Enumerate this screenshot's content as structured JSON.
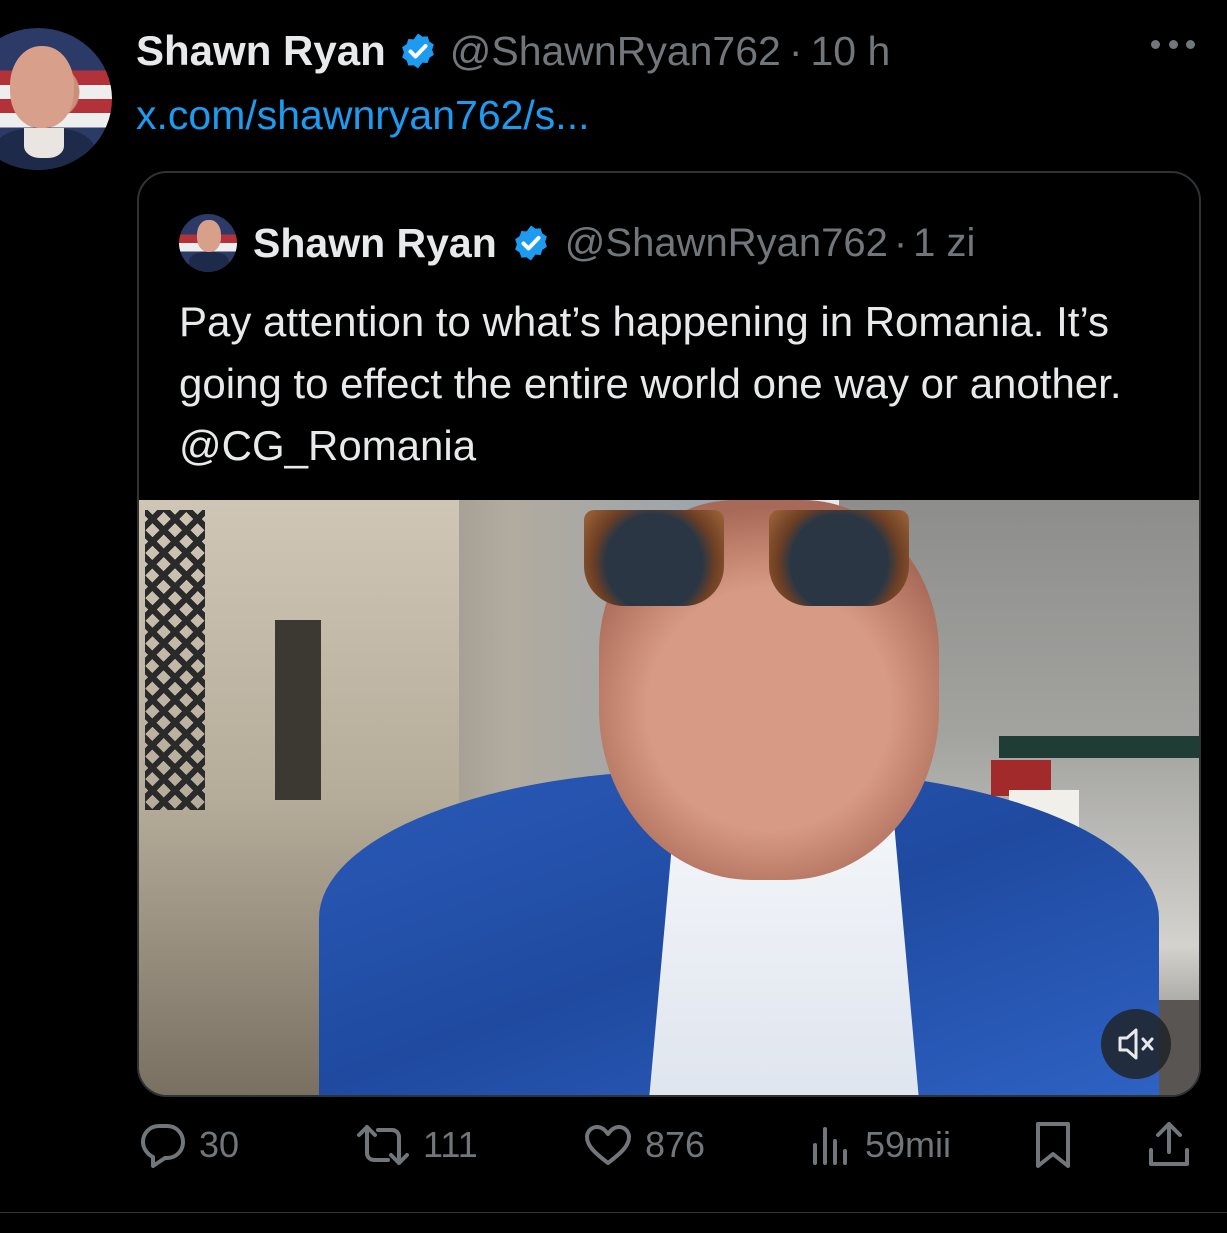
{
  "tweet": {
    "author_name": "Shawn Ryan",
    "author_handle": "@ShawnRyan762",
    "separator": "·",
    "timestamp": "10 h",
    "link_text": "x.com/shawnryan762/s..."
  },
  "quoted": {
    "author_name": "Shawn Ryan",
    "author_handle": "@ShawnRyan762",
    "separator": "·",
    "timestamp": "1 zi",
    "text": "Pay attention to what’s happening in Romania. It’s going to effect the entire world one way or another. @CG_Romania"
  },
  "actions": {
    "replies": "30",
    "reposts": "111",
    "likes": "876",
    "views": "59mii"
  },
  "colors": {
    "background": "#000000",
    "text": "#e7e9ea",
    "muted": "#71767b",
    "link": "#1d9bf0",
    "verified": "#1d9bf0",
    "border": "#2f3336"
  },
  "icons": [
    "more-icon",
    "verified-icon",
    "mute-icon",
    "reply-icon",
    "repost-icon",
    "like-icon",
    "views-icon",
    "bookmark-icon",
    "share-icon"
  ]
}
